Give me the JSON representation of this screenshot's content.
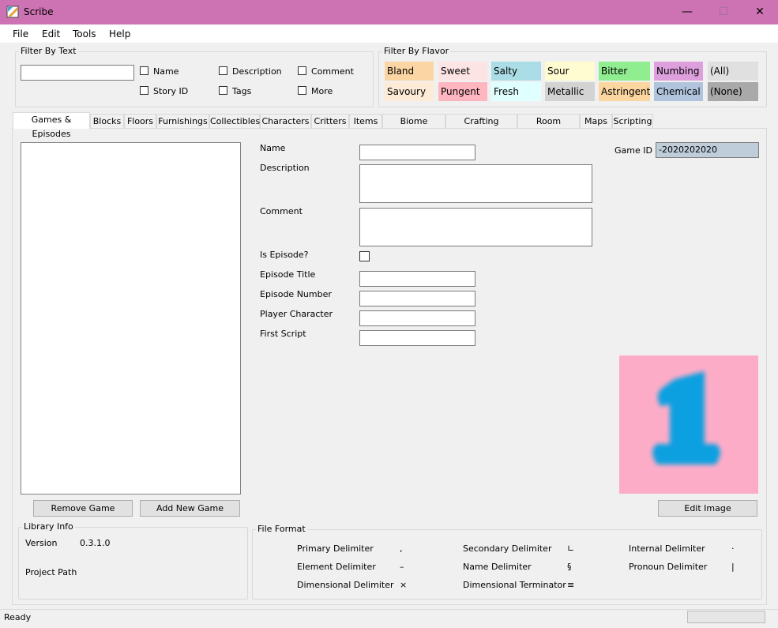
{
  "window": {
    "title": "Scribe",
    "minimize": "—",
    "maximize": "☐",
    "close": "✕"
  },
  "menu": [
    "File",
    "Edit",
    "Tools",
    "Help"
  ],
  "filter_text": {
    "label": "Filter By Text",
    "input_value": "",
    "checkboxes": [
      "Name",
      "Description",
      "Comment",
      "Story ID",
      "Tags",
      "More"
    ]
  },
  "filter_flavor": {
    "label": "Filter By Flavor",
    "flavors": [
      {
        "label": "Bland",
        "color": "#fbd5a3"
      },
      {
        "label": "Sweet",
        "color": "#fde4e4"
      },
      {
        "label": "Salty",
        "color": "#abdde6"
      },
      {
        "label": "Sour",
        "color": "#fefcd0"
      },
      {
        "label": "Bitter",
        "color": "#90ed90"
      },
      {
        "label": "Numbing",
        "color": "#dda0dd"
      },
      {
        "label": "(All)",
        "color": "#e0e0e0"
      },
      {
        "label": "Savoury",
        "color": "#fdebd7"
      },
      {
        "label": "Pungent",
        "color": "#ffb6c1"
      },
      {
        "label": "Fresh",
        "color": "#e0ffff"
      },
      {
        "label": "Metallic",
        "color": "#d3d3d3"
      },
      {
        "label": "Astringent",
        "color": "#fbd6a0"
      },
      {
        "label": "Chemical",
        "color": "#b0c4de"
      },
      {
        "label": "(None)",
        "color": "#a9a9a9"
      }
    ]
  },
  "tabs": [
    "Games & Episodes",
    "Blocks",
    "Floors",
    "Furnishings",
    "Collectibles",
    "Characters",
    "Critters",
    "Items",
    "Biome Recipes",
    "Crafting Recipes",
    "Room Recipes",
    "Maps",
    "Scripting"
  ],
  "form": {
    "name": "Name",
    "description": "Description",
    "comment": "Comment",
    "is_episode": "Is Episode?",
    "episode_title": "Episode Title",
    "episode_number": "Episode Number",
    "player_character": "Player Character",
    "first_script": "First Script",
    "game_id_label": "Game ID",
    "game_id_value": "-2020202020"
  },
  "buttons": {
    "remove_game": "Remove Game",
    "add_game": "Add New Game",
    "edit_image": "Edit Image"
  },
  "image": {
    "glyph": "1",
    "bg": "#fdacc8",
    "fg": "#0ea0e0"
  },
  "library_info": {
    "label": "Library Info",
    "version_label": "Version",
    "version_value": "0.3.1.0",
    "project_path_label": "Project Path"
  },
  "file_format": {
    "label": "File Format",
    "delimiters": [
      {
        "label": "Primary Delimiter",
        "symbol": ","
      },
      {
        "label": "Secondary Delimiter",
        "symbol": "∟"
      },
      {
        "label": "Internal Delimiter",
        "symbol": "·"
      },
      {
        "label": "Element Delimiter",
        "symbol": "–"
      },
      {
        "label": "Name Delimiter",
        "symbol": "§"
      },
      {
        "label": "Pronoun Delimiter",
        "symbol": "|"
      },
      {
        "label": "Dimensional Delimiter",
        "symbol": "×"
      },
      {
        "label": "Dimensional Terminator",
        "symbol": "≡"
      }
    ]
  },
  "status": {
    "text": "Ready"
  }
}
